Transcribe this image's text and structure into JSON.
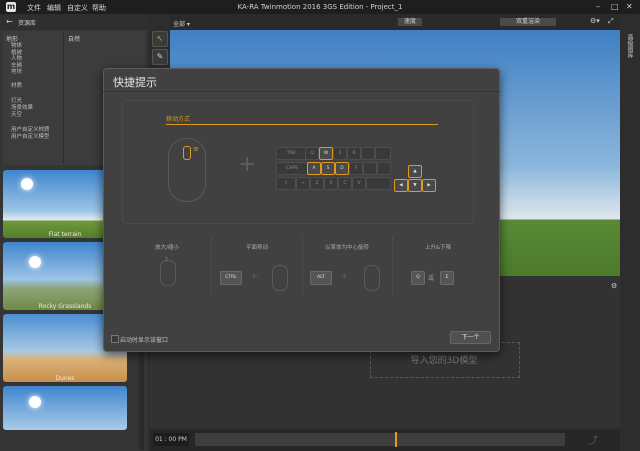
{
  "app": {
    "window_title": "KA-RA Twinmotion 2016 3GS Edition - Project_1",
    "logo_letter": "m",
    "menu": [
      "文件",
      "编辑",
      "自定义",
      "帮助"
    ]
  },
  "library": {
    "title": "资源库",
    "col_left_header": "地形",
    "col_right_header": "自然",
    "categories_a": [
      "物体",
      "植被",
      "人物",
      "车辆",
      "地块"
    ],
    "categories_b": [
      "材质"
    ],
    "categories_c": [
      "灯光",
      "场景效果",
      "天空"
    ],
    "categories_d": [
      "用户自定义材质",
      "用户自定义模型"
    ],
    "thumbnails": [
      {
        "label": "Flat terrain"
      },
      {
        "label": "Rocky Grasslands"
      },
      {
        "label": "Dunes"
      },
      {
        "label": ""
      }
    ]
  },
  "viewport": {
    "view_dropdown": "全部",
    "toolbar_button_1": "速度",
    "toolbar_button_2": "双重渲染",
    "drop_hint": "导入您的3D模型",
    "right_tab": "高级图库"
  },
  "timeline": {
    "time": "01 : 00",
    "play_label": "PM",
    "marker_position": 0.54
  },
  "dialog": {
    "title": "快捷提示",
    "section_title": "移动方式",
    "keys_row1": [
      "TAB",
      "Q",
      "W",
      "E",
      "R",
      "",
      ""
    ],
    "keys_row2": [
      "CAPS",
      "A",
      "S",
      "D",
      "F",
      "",
      ""
    ],
    "keys_row3": [
      "⇧",
      "<",
      "Z",
      "X",
      "C",
      "V",
      ""
    ],
    "arrow_keys": [
      "▲",
      "◀",
      "▼",
      "▶"
    ],
    "tips": [
      {
        "label": "放大/缩小"
      },
      {
        "label": "平面移动",
        "key": "CTRL"
      },
      {
        "label": "以某体为中心旋转",
        "key": "ALT"
      },
      {
        "label": "上升&下降",
        "key_a": "Q",
        "key_b": "E",
        "sep": "或"
      }
    ],
    "startup_checkbox_label": "启动时显示该窗口",
    "next_button": "下一个"
  },
  "colors": {
    "accent": "#e39a1c",
    "panel": "#353535",
    "dialog": "#414141"
  }
}
